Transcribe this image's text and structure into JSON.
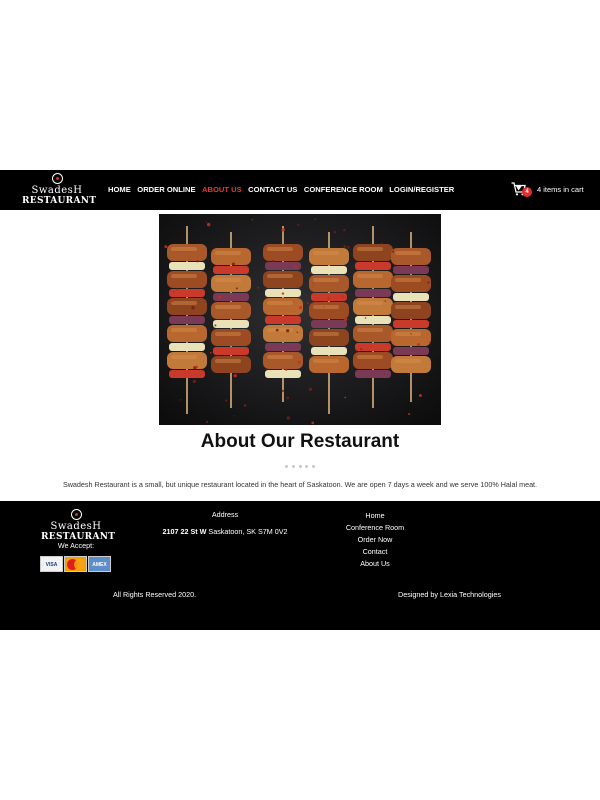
{
  "brand": {
    "line1": "SwadesH",
    "line2": "RESTAURANT"
  },
  "nav": {
    "items": [
      "HOME",
      "ORDER ONLINE",
      "ABOUT US",
      "CONTACT US",
      "CONFERENCE ROOM",
      "LOGIN/REGISTER"
    ],
    "active": "ABOUT US"
  },
  "cart": {
    "count": "4",
    "text": "4 items in cart"
  },
  "about": {
    "title": "About Our Restaurant",
    "text": "Swadesh Restaurant is a small, but unique restaurant located in the heart of Saskatoon. We are open 7 days a week and we serve 100% Halal meat."
  },
  "footer": {
    "we_accept": "We Accept:",
    "cards": [
      "VISA",
      "MasterCard",
      "AMERICAN EXPRESS"
    ],
    "address_heading": "Address",
    "address_street": "2107 22 St W",
    "address_city": "Saskatoon, SK S7M 0V2",
    "links": [
      "Home",
      "Conference Room",
      "Order Now",
      "Contact",
      "About Us"
    ],
    "copyright": "All Rights Reserved 2020.",
    "credit": "Designed by Lexia Technologies"
  },
  "colors": {
    "header_bg": "#000000",
    "active_nav": "#e23b34",
    "cart_badge": "#e52b2b",
    "footer_bg": "#000000"
  },
  "hero": {
    "image": "kebab-skewers-photo"
  }
}
